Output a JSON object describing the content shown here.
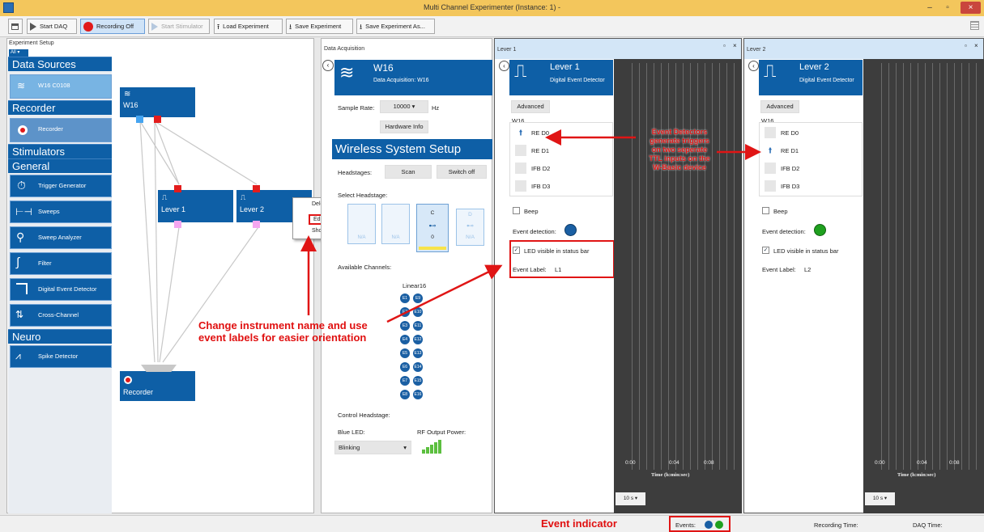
{
  "window": {
    "title": "Multi Channel Experimenter (Instance: 1) -",
    "min": "–",
    "max": "▫",
    "close": "×"
  },
  "toolbar": {
    "start_daq": "Start DAQ",
    "recording": "Recording Off",
    "start_stim": "Start Stimulator",
    "load": "Load Experiment",
    "save": "Save Experiment",
    "save_as": "Save Experiment As..."
  },
  "setup": {
    "title": "Experiment Setup",
    "filter": "All",
    "categories": {
      "sources": "Data Sources",
      "recorder": "Recorder",
      "stimulators": "Stimulators",
      "general": "General",
      "neuro": "Neuro"
    },
    "source_tile": "W16   C0108",
    "recorder_tile": "Recorder",
    "general_tiles": [
      "Trigger Generator",
      "Sweeps",
      "Sweep Analyzer",
      "Filter",
      "Digital Event Detector",
      "Cross-Channel"
    ],
    "neuro_tile": "Spike Detector",
    "nodes": {
      "w16": "W16",
      "lever1": "Lever 1",
      "lever2": "Lever 2",
      "recorder": "Recorder"
    },
    "context_menu": [
      "Delete Instrument",
      "Edit Instrument Name...",
      "Show Info..."
    ]
  },
  "daq": {
    "title": "Data Acquisition",
    "name": "W16",
    "subtitle": "Data Acquisition: W16",
    "sample_rate_label": "Sample Rate:",
    "sample_rate": "10000",
    "unit": "Hz",
    "hardware_info": "Hardware Info",
    "wireless_title": "Wireless System Setup",
    "headstages_label": "Headstages:",
    "scan": "Scan",
    "switch_off": "Switch off",
    "select_label": "Select Headstage:",
    "hs_c": "C",
    "hs_c_val": "0",
    "hs_d": "D",
    "hs_na": "N/A",
    "available_label": "Available Channels:",
    "linear": "Linear16",
    "channels_left": [
      "E1",
      "E2",
      "E3",
      "E4",
      "E5",
      "E6",
      "E7",
      "E8"
    ],
    "channels_right": [
      "E9",
      "E10",
      "E11",
      "E12",
      "E13",
      "E14",
      "E15",
      "E16"
    ],
    "control_label": "Control Headstage:",
    "blue_led_label": "Blue LED:",
    "rf_label": "RF Output Power:",
    "blue_led_value": "Blinking"
  },
  "lever1": {
    "panel_title": "Lever 1",
    "name": "Lever 1",
    "subtitle": "Digital Event Detector",
    "advanced": "Advanced",
    "group": "W16",
    "inputs": [
      "RE D0",
      "RE D1",
      "IFB D2",
      "IFB D3"
    ],
    "beep": "Beep",
    "event_detection": "Event detection:",
    "led_visible": "LED visible in status bar",
    "event_label_label": "Event Label:",
    "event_label": "L1",
    "ticks": [
      "0:00",
      "0:04",
      "0:08"
    ],
    "axis_label": "Time (h:min:sec)",
    "timebase": "10 s"
  },
  "lever2": {
    "panel_title": "Lever 2",
    "name": "Lever 2",
    "subtitle": "Digital Event Detector",
    "advanced": "Advanced",
    "group": "W16",
    "inputs": [
      "RE D0",
      "RE D1",
      "IFB D2",
      "IFB D3"
    ],
    "beep": "Beep",
    "event_detection": "Event detection:",
    "led_visible": "LED visible in status bar",
    "event_label_label": "Event Label:",
    "event_label": "L2",
    "ticks": [
      "0:00",
      "0:04",
      "0:08"
    ],
    "axis_label": "Time (h:min:sec)",
    "timebase": "10 s"
  },
  "annotations": {
    "detectors": [
      "Event Detectors",
      "generate triggers",
      "on two seperate",
      "TTL inputs on the",
      "W-Basic device"
    ],
    "change": [
      "Change instrument name and use",
      "event labels for easier orientation"
    ],
    "event_indicator": "Event indicator"
  },
  "status": {
    "events_label": "Events:",
    "recording_time": "Recording Time:",
    "daq_time": "DAQ Time:"
  },
  "colors": {
    "accent": "#0e5fa6",
    "title_bar": "#f3c65c",
    "annotation": "#e01515",
    "event_blue": "#1a5fa3",
    "event_green": "#1fa01f"
  }
}
